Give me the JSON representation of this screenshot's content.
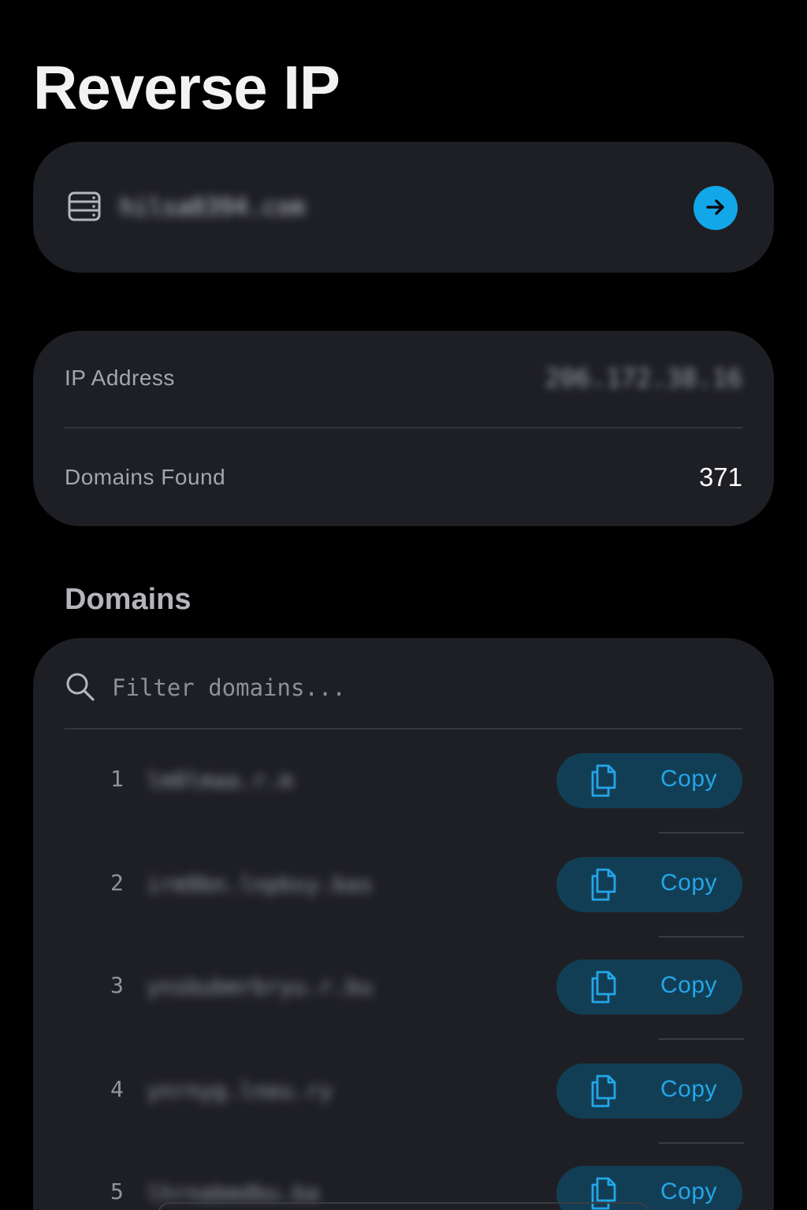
{
  "app": {
    "title": "Reverse IP"
  },
  "search": {
    "value": "hilsa0394.com",
    "go_icon": "arrow-right-icon",
    "left_icon": "server-icon",
    "accent": "#12a7e8"
  },
  "info": {
    "ip_label": "IP Address",
    "ip_value": "206.172.38.16",
    "domains_label": "Domains Found",
    "domains_value": "371"
  },
  "domains": {
    "heading": "Domains",
    "filter_placeholder": "Filter domains...",
    "copy_label": "Copy",
    "items": [
      {
        "num": "1",
        "domain": "lm0lmaa.r.m"
      },
      {
        "num": "2",
        "domain": "irm9bn.lnpbsy.bas"
      },
      {
        "num": "3",
        "domain": "ynsbubmrbryu.r.bu"
      },
      {
        "num": "4",
        "domain": "ynrnyg.lneu.ry"
      },
      {
        "num": "5",
        "domain": "lhrnabmdbu.ba"
      }
    ]
  }
}
